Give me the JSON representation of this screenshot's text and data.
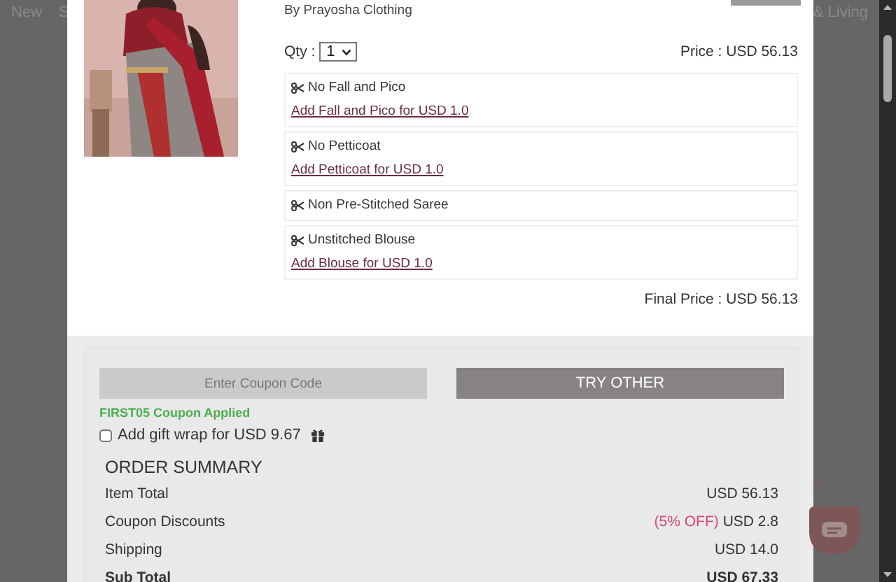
{
  "background_nav": {
    "items": [
      "New",
      "S",
      "& Living"
    ]
  },
  "product": {
    "brand": "By Prayosha Clothing",
    "qty_label": "Qty :",
    "qty": "1",
    "price": "Price : USD 56.13",
    "options": [
      {
        "label": "No Fall and Pico",
        "link": "Add Fall and Pico for USD 1.0"
      },
      {
        "label": "No Petticoat",
        "link": "Add Petticoat for USD 1.0"
      },
      {
        "label": "Non Pre-Stitched Saree"
      },
      {
        "label": "Unstitched Blouse",
        "link": "Add Blouse for USD 1.0"
      }
    ],
    "final_price": "Final Price : USD 56.13"
  },
  "coupon": {
    "placeholder": "Enter Coupon Code",
    "button": "TRY OTHER",
    "status": "FIRST05 Coupon Applied"
  },
  "gift_wrap": {
    "label": "Add gift wrap for USD 9.67",
    "checked": false
  },
  "order_summary": {
    "title": "ORDER SUMMARY",
    "rows": [
      {
        "label": "Item Total",
        "value": "USD 56.13"
      },
      {
        "label": "Coupon Discounts",
        "note": "(5% OFF)",
        "value": "USD 2.8"
      },
      {
        "label": "Shipping",
        "value": "USD 14.0"
      },
      {
        "label": "Sub Total",
        "value": "USD 67.33",
        "kind": "total"
      }
    ]
  }
}
